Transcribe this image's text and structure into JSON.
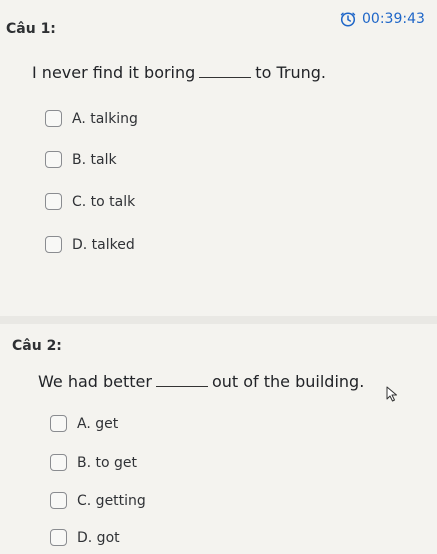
{
  "timer": {
    "icon": "clock-icon",
    "value": "00:39:43"
  },
  "questions": [
    {
      "number": "Câu 1:",
      "text_before": "I never find it boring",
      "text_after": "to Trung.",
      "options": [
        "A. talking",
        "B. talk",
        "C. to talk",
        "D. talked"
      ]
    },
    {
      "number": "Câu 2:",
      "text_before": "We had better",
      "text_after": "out of the building.",
      "options": [
        "A. get",
        "B. to get",
        "C. getting",
        "D. got"
      ]
    }
  ]
}
